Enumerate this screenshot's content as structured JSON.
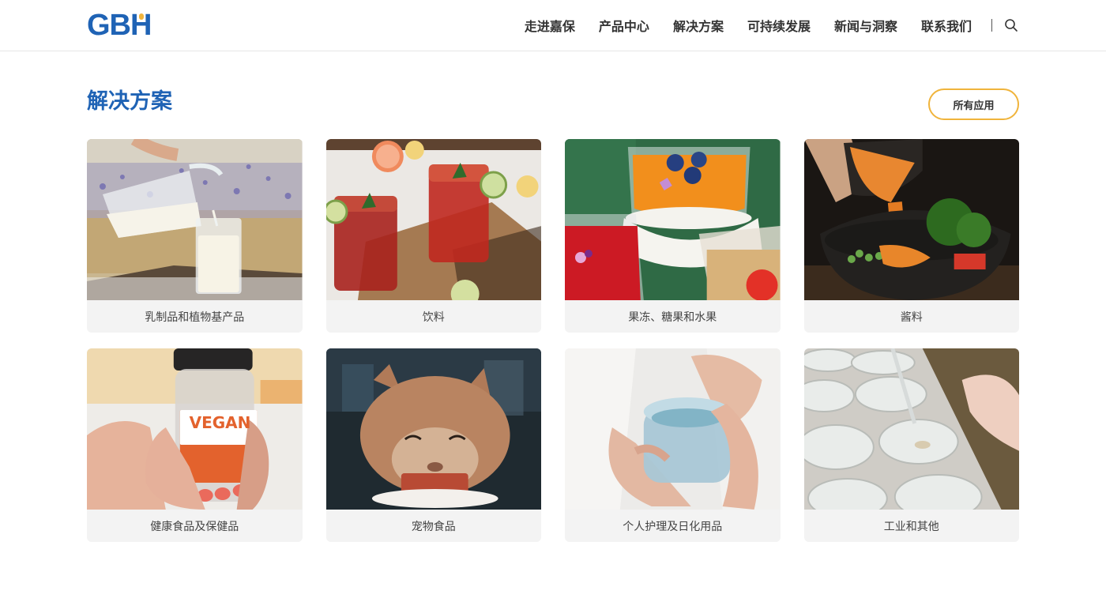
{
  "brand": {
    "logo_text": "GBH",
    "blue": "#1f63b5",
    "gold": "#f0b43c"
  },
  "nav": {
    "items": [
      "走进嘉保",
      "产品中心",
      "解决方案",
      "可持续发展",
      "新闻与洞察",
      "联系我们"
    ],
    "search_icon": "search-icon"
  },
  "section": {
    "title": "解决方案",
    "all_button": "所有应用"
  },
  "cards": [
    {
      "label": "乳制品和植物基产品",
      "image": "milk-pouring-image"
    },
    {
      "label": "饮料",
      "image": "iced-drinks-image"
    },
    {
      "label": "果冻、糖果和水果",
      "image": "jelly-dessert-image"
    },
    {
      "label": "酱料",
      "image": "sauce-bowl-image"
    },
    {
      "label": "健康食品及保健品",
      "image": "vegan-supplement-image",
      "image_text": "VEGAN"
    },
    {
      "label": "宠物食品",
      "image": "cat-eating-image"
    },
    {
      "label": "个人护理及日化用品",
      "image": "cream-jar-image"
    },
    {
      "label": "工业和其他",
      "image": "petri-dishes-image"
    }
  ]
}
